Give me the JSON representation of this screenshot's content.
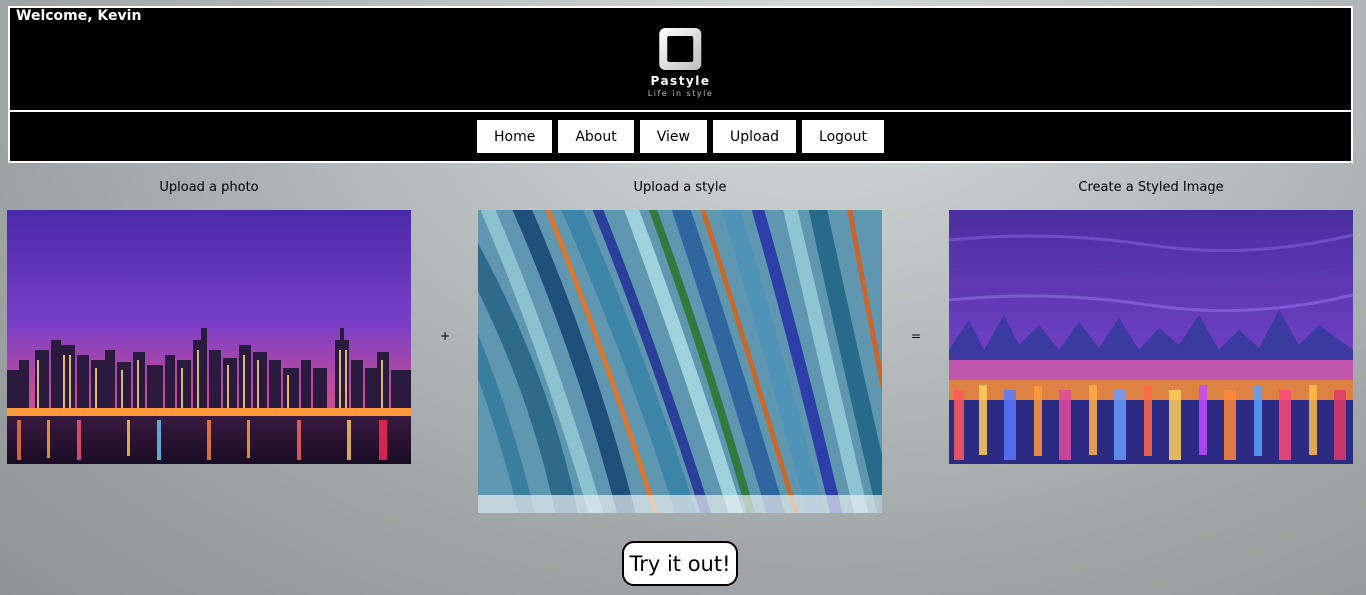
{
  "header": {
    "welcome": "Welcome, Kevin",
    "brand": "Pastyle",
    "tagline": "Life in style"
  },
  "nav": {
    "items": [
      "Home",
      "About",
      "View",
      "Upload",
      "Logout"
    ]
  },
  "columns": {
    "photo_title": "Upload a photo",
    "style_title": "Upload a style",
    "result_title": "Create a Styled Image",
    "plus": "+",
    "equals": "="
  },
  "cta": {
    "label": "Try it out!"
  }
}
